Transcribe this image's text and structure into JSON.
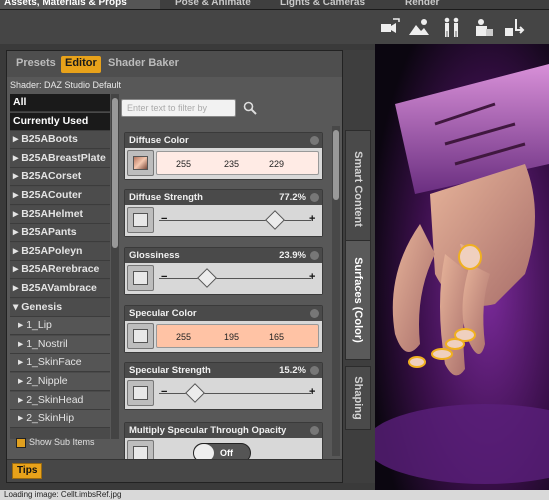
{
  "top_tabs": [
    "Assets, Materials & Props",
    "Pose & Animate",
    "Lights & Cameras",
    "Render"
  ],
  "panel": {
    "tabs": [
      "Presets",
      "Editor",
      "Shader Baker"
    ],
    "active_tab": "Editor",
    "shader_label": "Shader: DAZ Studio Default",
    "filter_placeholder": "Enter text to filter by",
    "categories": [
      {
        "label": "All",
        "selected": true,
        "sub": false
      },
      {
        "label": "Currently Used",
        "selected": true,
        "sub": false
      },
      {
        "label": "▸ B25ABoots",
        "selected": false,
        "sub": false
      },
      {
        "label": "▸ B25ABreastPlate",
        "selected": false,
        "sub": false
      },
      {
        "label": "▸ B25ACorset",
        "selected": false,
        "sub": false
      },
      {
        "label": "▸ B25ACouter",
        "selected": false,
        "sub": false
      },
      {
        "label": "▸ B25AHelmet",
        "selected": false,
        "sub": false
      },
      {
        "label": "▸ B25APants",
        "selected": false,
        "sub": false
      },
      {
        "label": "▸ B25APoleyn",
        "selected": false,
        "sub": false
      },
      {
        "label": "▸ B25ARerebrace",
        "selected": false,
        "sub": false
      },
      {
        "label": "▸ B25AVambrace",
        "selected": false,
        "sub": false
      },
      {
        "label": "▾ Genesis",
        "selected": false,
        "sub": false
      },
      {
        "label": "▸ 1_Lip",
        "selected": false,
        "sub": true
      },
      {
        "label": "▸ 1_Nostril",
        "selected": false,
        "sub": true
      },
      {
        "label": "▸ 1_SkinFace",
        "selected": false,
        "sub": true
      },
      {
        "label": "▸ 2_Nipple",
        "selected": false,
        "sub": true
      },
      {
        "label": "▸ 2_SkinHead",
        "selected": false,
        "sub": true
      },
      {
        "label": "▸ 2_SkinHip",
        "selected": false,
        "sub": true
      }
    ],
    "show_sub_items": "Show Sub Items",
    "tips_label": "Tips",
    "properties": [
      {
        "name": "Diffuse Color",
        "kind": "color",
        "rgb": [
          255,
          235,
          229
        ],
        "color": "#ffebe5"
      },
      {
        "name": "Diffuse Strength",
        "kind": "slider",
        "value": "77.2%",
        "fraction": 0.772
      },
      {
        "name": "Glossiness",
        "kind": "slider",
        "value": "23.9%",
        "fraction": 0.239
      },
      {
        "name": "Specular Color",
        "kind": "color",
        "rgb": [
          255,
          195,
          165
        ],
        "color": "#ffc3a5"
      },
      {
        "name": "Specular Strength",
        "kind": "slider",
        "value": "15.2%",
        "fraction": 0.152
      },
      {
        "name": "Multiply Specular Through Opacity",
        "kind": "toggle",
        "value": "Off"
      }
    ]
  },
  "side_tabs": [
    "Smart Content",
    "Surfaces (Color)",
    "Shaping"
  ],
  "active_side_tab": "Surfaces (Color)",
  "status": "Loading image: Cellt.imbsRef.jpg"
}
